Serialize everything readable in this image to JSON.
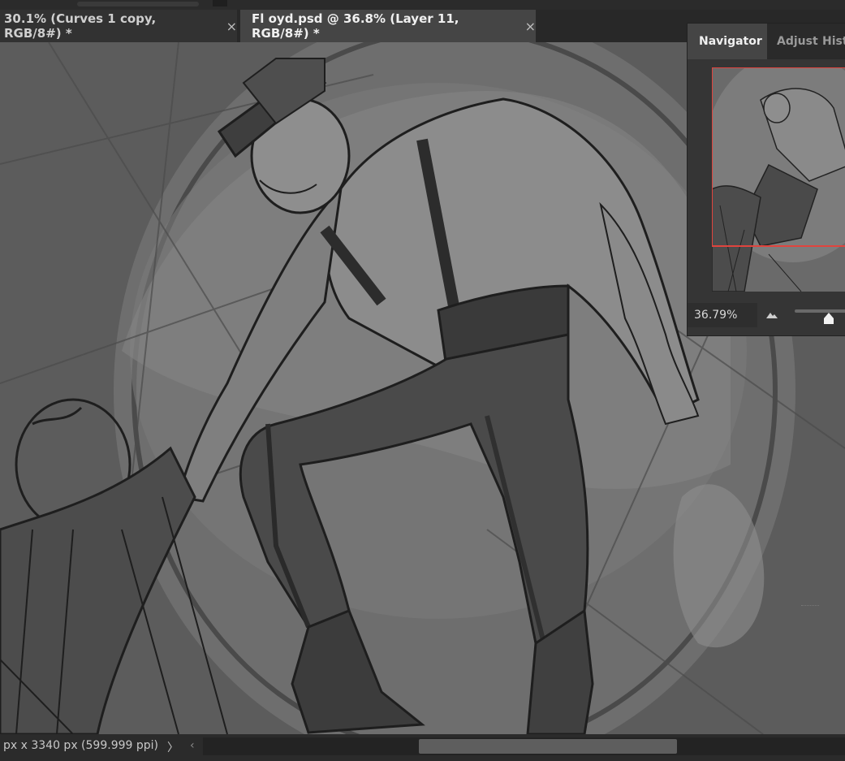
{
  "document_tabs": [
    {
      "label": "30.1% (Curves 1 copy, RGB/8#) *",
      "close": "×",
      "active": false
    },
    {
      "label": "Fl oyd.psd @ 36.8% (Layer 11, RGB/8#) *",
      "close": "×",
      "active": true
    }
  ],
  "navigator": {
    "tabs": [
      "Navigator",
      "Adjust",
      "Hist"
    ],
    "zoom_value": "36.79%",
    "zoom_slider_fraction": 0.62
  },
  "status": {
    "document_size": "px x 3340 px (599.999 ppi)",
    "arrow_right": "〉",
    "arrow_left": "‹"
  },
  "colors": {
    "view_box_outline": "#e0443e",
    "panel_bg": "#353535",
    "tabbar_bg": "#282828"
  }
}
